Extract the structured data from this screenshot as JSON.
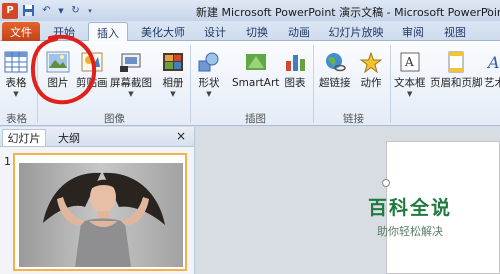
{
  "window": {
    "title": "新建 Microsoft PowerPoint 演示文稿 - Microsoft PowerPoint",
    "app_icon": "P"
  },
  "tabs": [
    "文件",
    "开始",
    "插入",
    "美化大师",
    "设计",
    "切换",
    "动画",
    "幻灯片放映",
    "审阅",
    "视图"
  ],
  "ribbon": {
    "table": "表格",
    "picture": "图片",
    "clipart": "剪贴画",
    "screenshot": "屏幕截图",
    "album": "相册",
    "shapes": "形状",
    "smartart": "SmartArt",
    "chart": "图表",
    "hyperlink": "超链接",
    "action": "动作",
    "textbox": "文本框",
    "header_footer": "页眉和页脚",
    "wordart": "艺术",
    "groups": {
      "tables": "表格",
      "images": "图像",
      "illustrations": "插图",
      "links": "链接"
    }
  },
  "pane": {
    "tab_slides": "幻灯片",
    "tab_outline": "大纲",
    "close": "×",
    "slide_number": "1"
  },
  "watermark": {
    "main": "百科全说",
    "sub": "助你轻松解决"
  },
  "colors": {
    "file_tab": "#d04a21",
    "thumb_border": "#f2b44a",
    "annotation_circle": "#e0201b",
    "watermark": "#1f7a3d"
  }
}
